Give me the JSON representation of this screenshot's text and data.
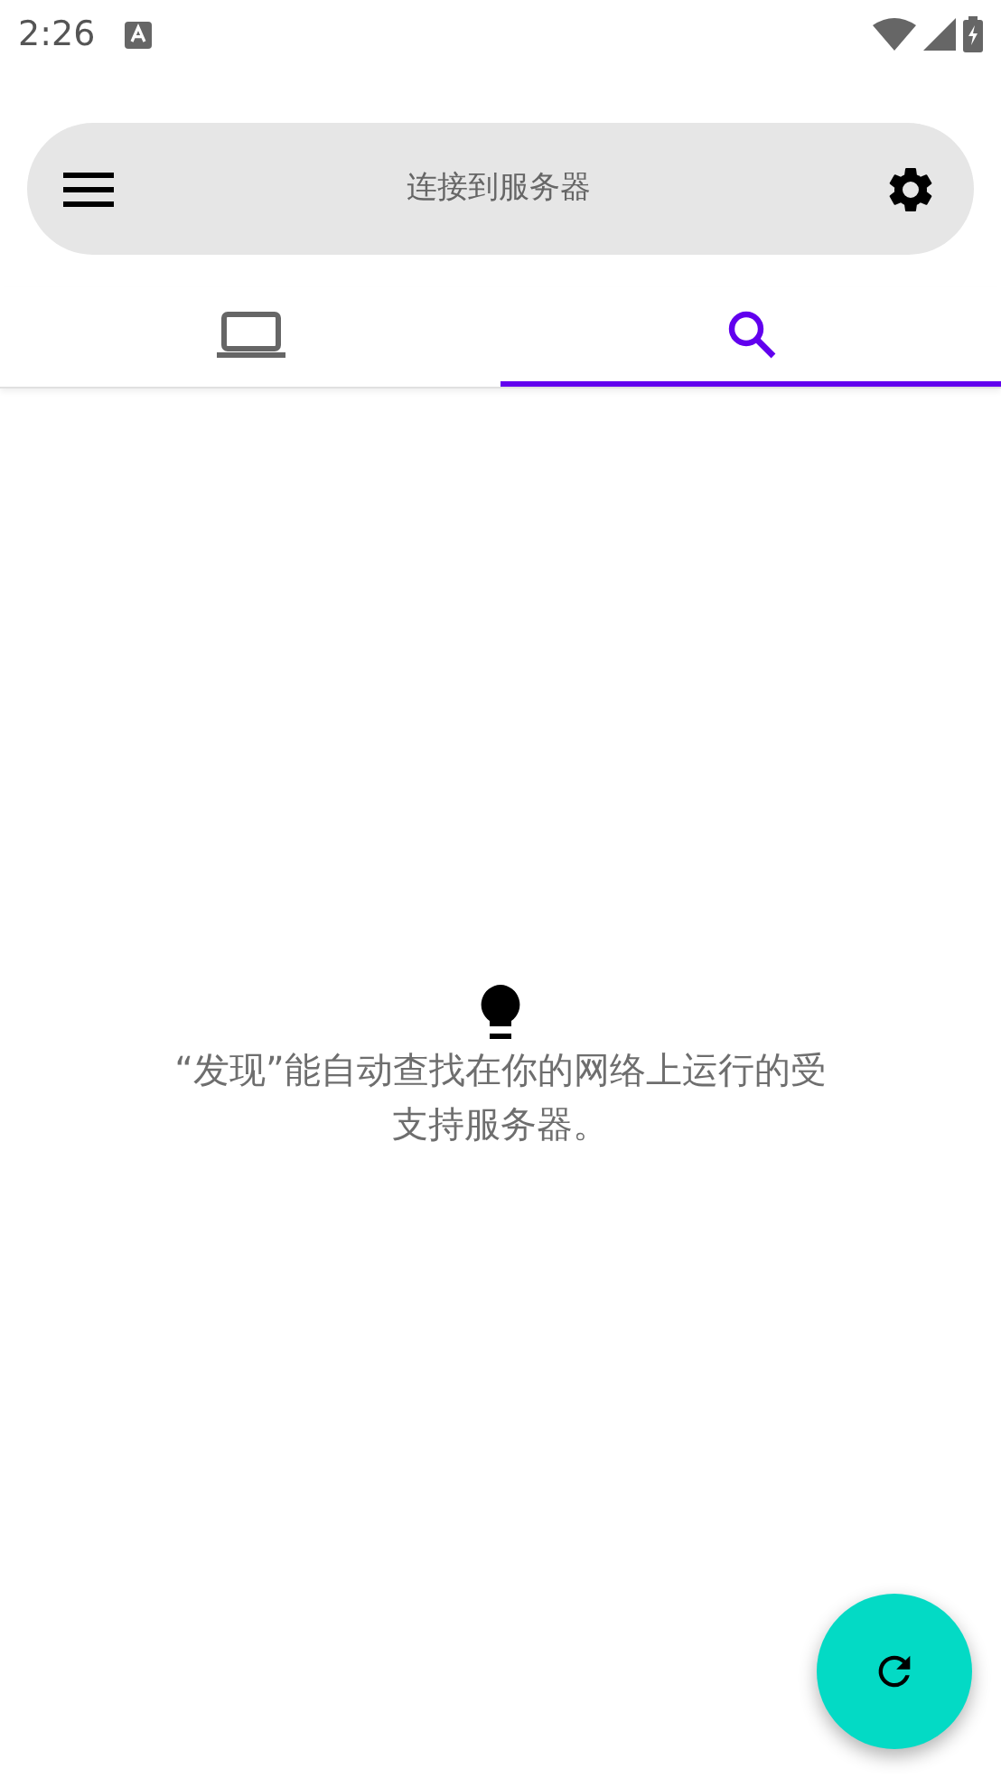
{
  "status_bar": {
    "time": "2:26"
  },
  "search_bar": {
    "title": "连接到服务器"
  },
  "tabs": [
    {
      "kind": "devices",
      "selected": false
    },
    {
      "kind": "discover",
      "selected": true
    }
  ],
  "empty_state": {
    "message": "“发现”能自动查找在你的网络上运行的受支持服务器。"
  }
}
